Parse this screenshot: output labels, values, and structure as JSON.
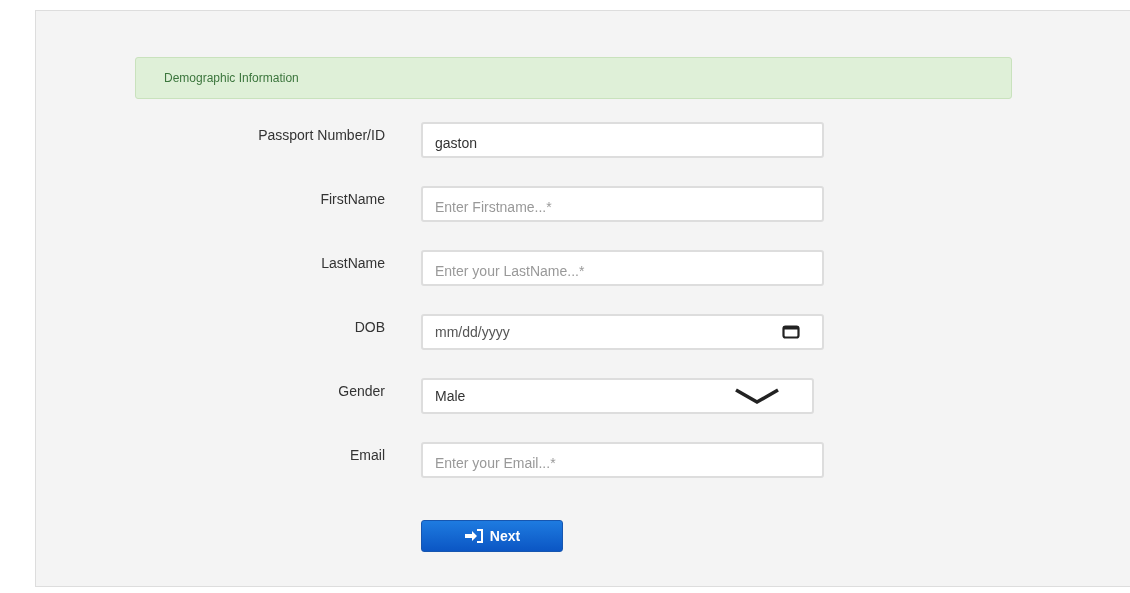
{
  "panel": {
    "heading": "Demographic Information"
  },
  "fields": [
    {
      "label": "Passport Number/ID",
      "kind": "text",
      "value": "gaston"
    },
    {
      "label": "FirstName",
      "kind": "text",
      "placeholder": "Enter Firstname...*"
    },
    {
      "label": "LastName",
      "kind": "text",
      "placeholder": "Enter your LastName...*"
    },
    {
      "label": "DOB",
      "kind": "date",
      "placeholder": "mm/dd/yyyy"
    },
    {
      "label": "Gender",
      "kind": "select",
      "value": "Male"
    },
    {
      "label": "Email",
      "kind": "text",
      "placeholder": "Enter your Email...*"
    }
  ],
  "button": {
    "label": "Next"
  }
}
